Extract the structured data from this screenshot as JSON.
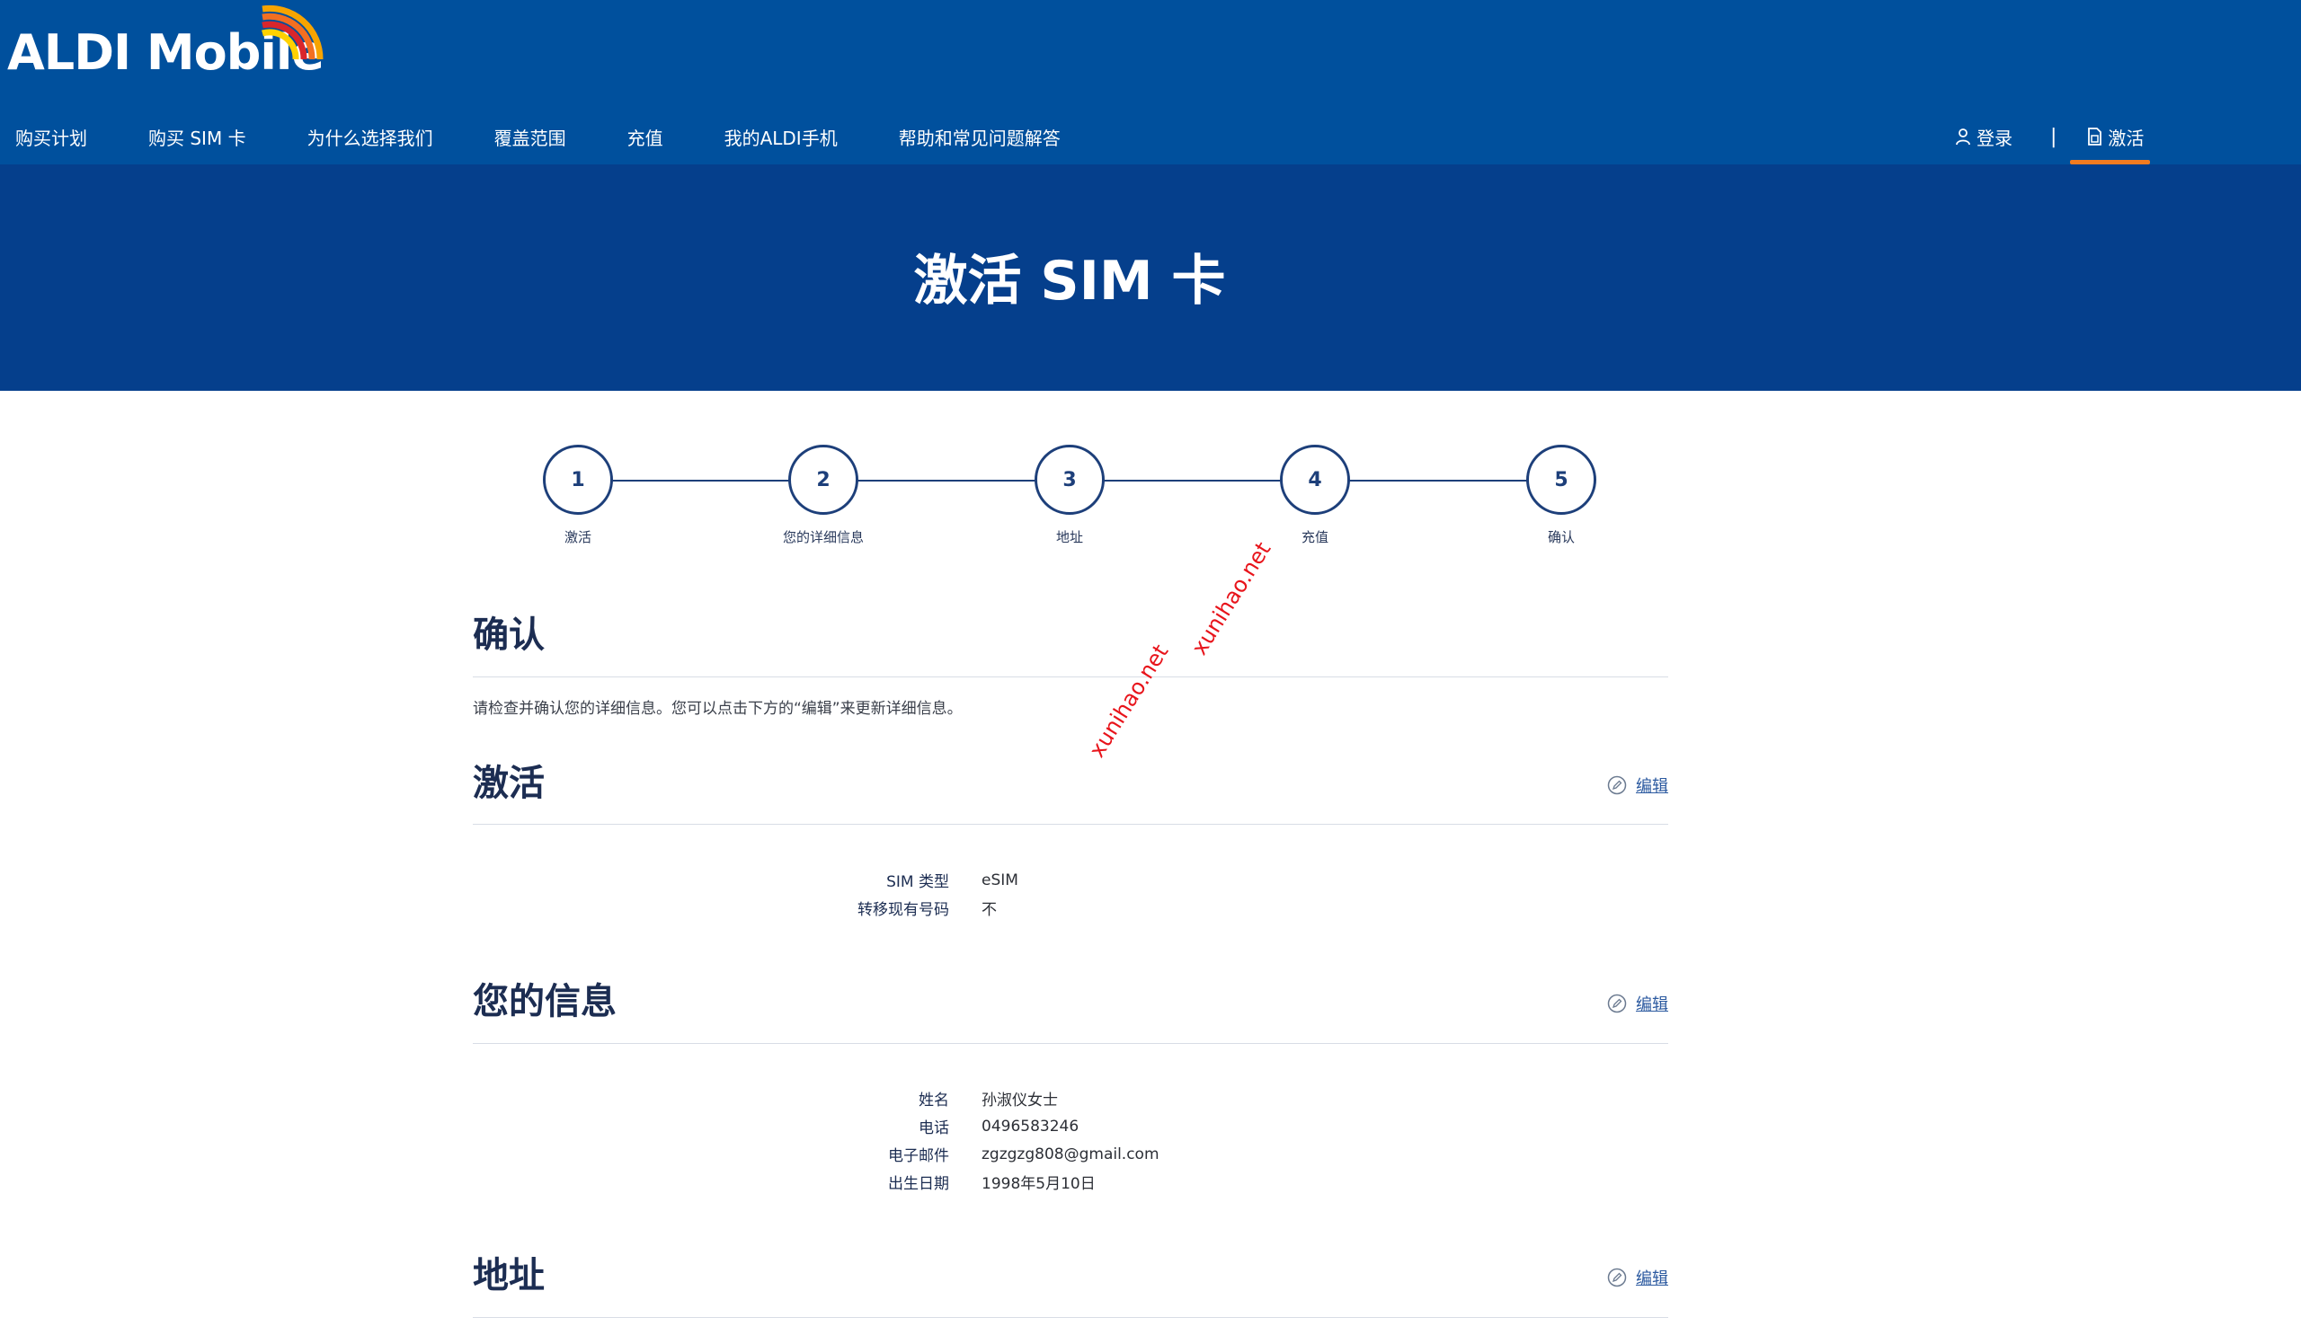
{
  "header": {
    "logo_text": "ALDI Mobile",
    "nav": [
      "购买计划",
      "购买 SIM 卡",
      "为什么选择我们",
      "覆盖范围",
      "充值",
      "我的ALDI手机",
      "帮助和常见问题解答"
    ],
    "login_label": "登录",
    "separator": "|",
    "activate_label": "激活"
  },
  "hero": {
    "title": "激活 SIM 卡"
  },
  "steps": [
    {
      "number": "1",
      "label": "激活"
    },
    {
      "number": "2",
      "label": "您的详细信息"
    },
    {
      "number": "3",
      "label": "地址"
    },
    {
      "number": "4",
      "label": "充值"
    },
    {
      "number": "5",
      "label": "确认"
    }
  ],
  "confirm": {
    "title": "确认",
    "intro": "请检查并确认您的详细信息。您可以点击下方的“编辑”来更新详细信息。"
  },
  "activation": {
    "title": "激活",
    "edit_label": "编辑",
    "rows": [
      {
        "label": "SIM 类型",
        "value": "eSIM"
      },
      {
        "label": "转移现有号码",
        "value": "不"
      }
    ]
  },
  "your_info": {
    "title": "您的信息",
    "edit_label": "编辑",
    "rows": [
      {
        "label": "姓名",
        "value": "孙淑仪女士"
      },
      {
        "label": "电话",
        "value": "0496583246"
      },
      {
        "label": "电子邮件",
        "value": "zgzgzg808@gmail.com"
      },
      {
        "label": "出生日期",
        "value": "1998年5月10日"
      }
    ]
  },
  "address": {
    "title": "地址",
    "edit_label": "编辑"
  },
  "watermarks": [
    "xunihao.net",
    "xunihao.net"
  ],
  "colors": {
    "header_bg": "#00509d",
    "hero_bg": "#053f8c",
    "accent": "#f47b20",
    "step_color": "#1d3f7a",
    "link": "#2c5aa0"
  }
}
